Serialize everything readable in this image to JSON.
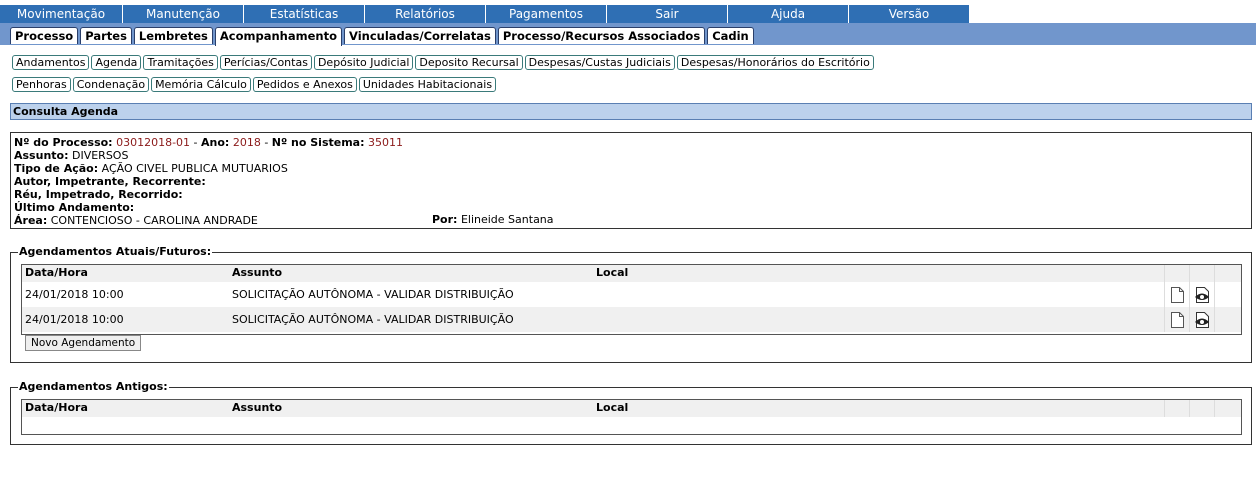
{
  "menu": [
    "Movimentação",
    "Manutenção",
    "Estatísticas",
    "Relatórios",
    "Pagamentos",
    "Sair",
    "Ajuda",
    "Versão"
  ],
  "tabs": [
    "Processo",
    "Partes",
    "Lembretes",
    "Acompanhamento",
    "Vinculadas/Correlatas",
    "Processo/Recursos Associados",
    "Cadin"
  ],
  "active_tab": "Acompanhamento",
  "subtabs_row1": [
    "Andamentos",
    "Agenda",
    "Tramitações",
    "Perícias/Contas",
    "Depósito Judicial",
    "Deposito Recursal",
    "Despesas/Custas Judiciais",
    "Despesas/Honorários do Escritório"
  ],
  "subtabs_row2": [
    "Penhoras",
    "Condenação",
    "Memória Cálculo",
    "Pedidos e Anexos",
    "Unidades Habitacionais"
  ],
  "section_title": "Consulta Agenda",
  "info": {
    "processo_label": "Nº do Processo:",
    "processo_value": "03012018-01",
    "ano_label": "Ano:",
    "ano_value": "2018",
    "sistema_label": "Nº no Sistema:",
    "sistema_value": "35011",
    "assunto_label": "Assunto:",
    "assunto_value": "DIVERSOS",
    "tipo_label": "Tipo de Ação:",
    "tipo_value": "AÇÃO CIVEL PUBLICA MUTUARIOS",
    "autor_label": "Autor, Impetrante, Recorrente:",
    "reu_label": "Réu, Impetrado, Recorrido:",
    "ultimo_label": "Último Andamento:",
    "area_label": "Área:",
    "area_value": "CONTENCIOSO - CAROLINA ANDRADE",
    "por_label": "Por:",
    "por_value": "Elineide Santana"
  },
  "atuais": {
    "legend": "Agendamentos Atuais/Futuros:",
    "headers": [
      "Data/Hora",
      "Assunto",
      "Local"
    ],
    "rows": [
      {
        "data": "24/01/2018 10:00",
        "assunto": "SOLICITAÇÃO AUTÔNOMA - VALIDAR DISTRIBUIÇÃO",
        "local": ""
      },
      {
        "data": "24/01/2018 10:00",
        "assunto": "SOLICITAÇÃO AUTÔNOMA - VALIDAR DISTRIBUIÇÃO",
        "local": ""
      }
    ],
    "button": "Novo Agendamento"
  },
  "antigos": {
    "legend": "Agendamentos Antigos:",
    "headers": [
      "Data/Hora",
      "Assunto",
      "Local"
    ]
  }
}
